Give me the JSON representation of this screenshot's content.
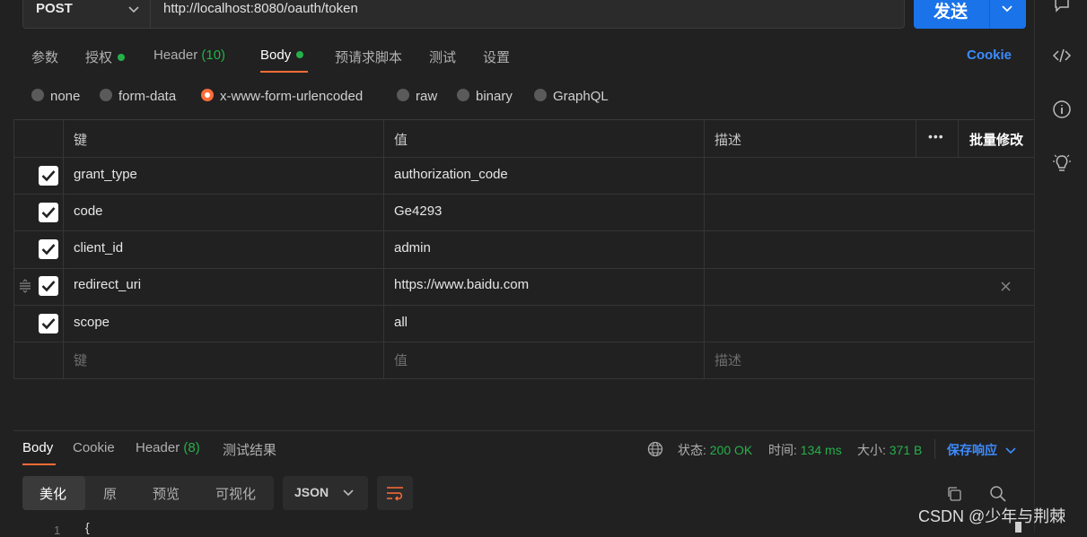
{
  "request": {
    "method": "POST",
    "url": "http://localhost:8080/oauth/token",
    "send_label": "发送"
  },
  "tabs": {
    "params": "参数",
    "auth": "授权",
    "header": "Header",
    "header_count": "(10)",
    "body": "Body",
    "prerequest": "预请求脚本",
    "tests": "测试",
    "settings": "设置",
    "cookie": "Cookie"
  },
  "body_types": {
    "none": "none",
    "form_data": "form-data",
    "urlencoded": "x-www-form-urlencoded",
    "raw": "raw",
    "binary": "binary",
    "graphql": "GraphQL",
    "selected": "x-www-form-urlencoded"
  },
  "table": {
    "headers": {
      "key": "键",
      "value": "值",
      "desc": "描述",
      "more": "•••",
      "bulk_edit": "批量修改"
    },
    "rows": [
      {
        "key": "grant_type",
        "value": "authorization_code",
        "desc": "",
        "checked": true
      },
      {
        "key": "code",
        "value": "Ge4293",
        "desc": "",
        "checked": true
      },
      {
        "key": "client_id",
        "value": "admin",
        "desc": "",
        "checked": true
      },
      {
        "key": "redirect_uri",
        "value": "https://www.baidu.com",
        "desc": "",
        "checked": true
      },
      {
        "key": "scope",
        "value": "all",
        "desc": "",
        "checked": true
      }
    ],
    "placeholder": {
      "key": "键",
      "value": "值",
      "desc": "描述"
    }
  },
  "response": {
    "tabs": {
      "body": "Body",
      "cookie": "Cookie",
      "header": "Header",
      "header_count": "(8)",
      "test_results": "测试结果"
    },
    "status_label": "状态:",
    "status_value": "200 OK",
    "time_label": "时间:",
    "time_value": "134 ms",
    "size_label": "大小:",
    "size_value": "371 B",
    "save_label": "保存响应",
    "views": {
      "pretty": "美化",
      "raw": "原",
      "preview": "预览",
      "visualize": "可视化"
    },
    "format": "JSON",
    "line_number": "1",
    "first_char": "{"
  },
  "watermark": "CSDN @少年与荆棘",
  "colors": {
    "accent": "#ff6c37",
    "success": "#26b04a",
    "link": "#3d8bfd",
    "send": "#1a73e8"
  }
}
